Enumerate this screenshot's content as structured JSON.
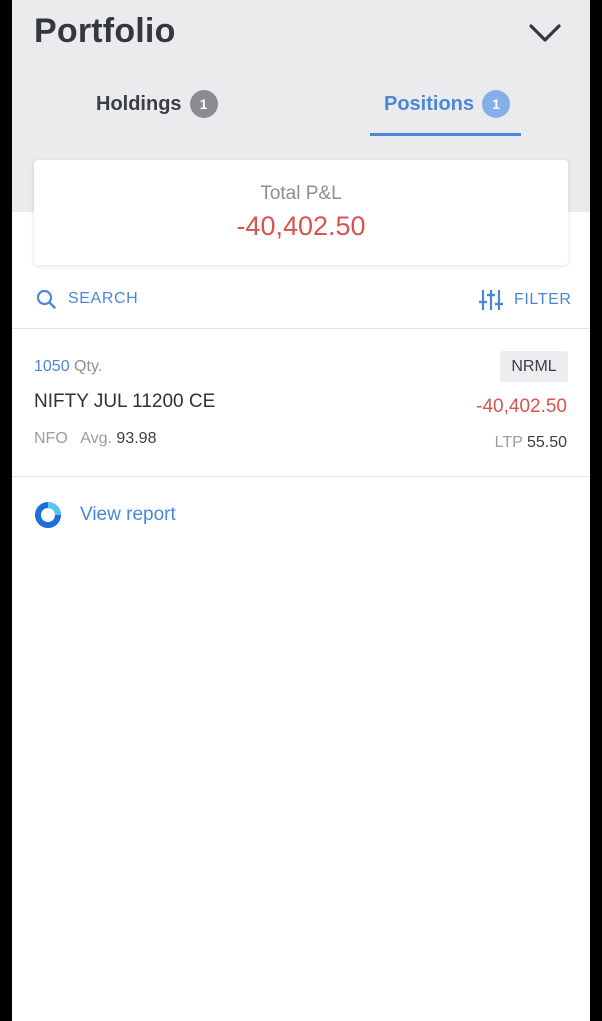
{
  "header": {
    "title": "Portfolio",
    "collapse_icon": "chevron-down-icon"
  },
  "tabs": [
    {
      "label": "Holdings",
      "count": "1",
      "active": false
    },
    {
      "label": "Positions",
      "count": "1",
      "active": true
    }
  ],
  "summary": {
    "label": "Total P&L",
    "value": "-40,402.50"
  },
  "toolbar": {
    "search_label": "SEARCH",
    "search_icon": "search-icon",
    "filter_label": "FILTER",
    "filter_icon": "sliders-icon"
  },
  "positions": [
    {
      "qty": "1050",
      "qty_unit": "Qty.",
      "instrument": "NIFTY JUL 11200 CE",
      "exchange": "NFO",
      "avg_label": "Avg.",
      "avg_value": "93.98",
      "product": "NRML",
      "pnl": "-40,402.50",
      "ltp_label": "LTP",
      "ltp_value": "55.50"
    }
  ],
  "report": {
    "label": "View report",
    "icon": "report-ring-icon"
  },
  "colors": {
    "accent": "#4a87d8",
    "loss": "#d9534f",
    "header_bg": "#ebebed",
    "title_text": "#333840"
  }
}
